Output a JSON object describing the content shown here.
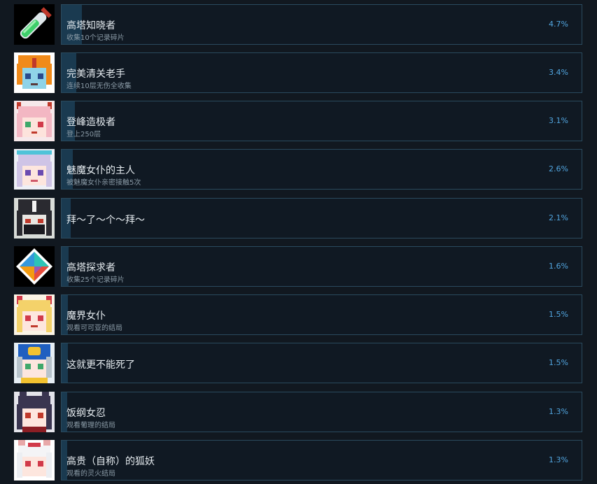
{
  "achievements": [
    {
      "title": "高塔知晓者",
      "description": "收集10个记录碎片",
      "percent": "4.7%",
      "percent_value": 4.7,
      "icon": "potion-tube-icon"
    },
    {
      "title": "完美清关老手",
      "description": "连续10层无伤全收集",
      "percent": "3.4%",
      "percent_value": 3.4,
      "icon": "orange-hair-girl-icon"
    },
    {
      "title": "登峰造极者",
      "description": "登上250层",
      "percent": "3.1%",
      "percent_value": 3.1,
      "icon": "pink-hair-horned-girl-icon"
    },
    {
      "title": "魅魔女仆的主人",
      "description": "被魅魔女仆亲密接触5次",
      "percent": "2.6%",
      "percent_value": 2.6,
      "icon": "succubus-maid-icon"
    },
    {
      "title": "拜～了～个～拜～",
      "description": "",
      "percent": "2.1%",
      "percent_value": 2.1,
      "icon": "masked-girl-icon"
    },
    {
      "title": "高塔探求者",
      "description": "收集25个记录碎片",
      "percent": "1.6%",
      "percent_value": 1.6,
      "icon": "colorful-diamond-icon"
    },
    {
      "title": "魔界女仆",
      "description": "观看可可亚的结局",
      "percent": "1.5%",
      "percent_value": 1.5,
      "icon": "blonde-demon-maid-icon"
    },
    {
      "title": "这就更不能死了",
      "description": "",
      "percent": "1.5%",
      "percent_value": 1.5,
      "icon": "cap-girl-icon"
    },
    {
      "title": "饭纲女忍",
      "description": "观看葡理的结局",
      "percent": "1.3%",
      "percent_value": 1.3,
      "icon": "ninja-girl-icon"
    },
    {
      "title": "高贵（自称）的狐妖",
      "description": "观看的灵火结局",
      "percent": "1.3%",
      "percent_value": 1.3,
      "icon": "fox-girl-icon"
    }
  ],
  "colors": {
    "background": "#111820",
    "panel_border": "#2a4a5e",
    "progress_fill": "#1a3a50",
    "title": "#e6ecf0",
    "description": "#8a9aa6",
    "percent": "#52a6e0"
  }
}
